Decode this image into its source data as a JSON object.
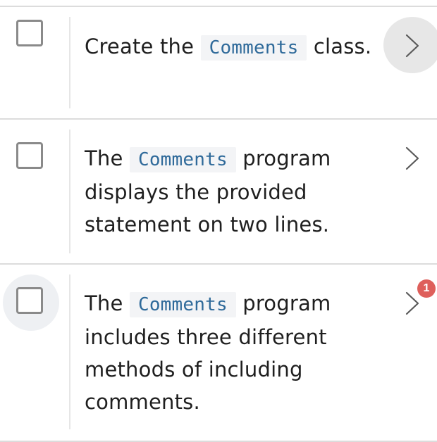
{
  "tasks": [
    {
      "before": "Create the ",
      "code": "Comments",
      "after": " class.",
      "checked": false
    },
    {
      "before": "The ",
      "code": "Comments",
      "after": " program displays the provided statement on two lines.",
      "checked": false
    },
    {
      "before": "The ",
      "code": "Comments",
      "after": " program includes three different methods of including comments.",
      "checked": false,
      "badge": "1"
    }
  ],
  "icons": {
    "checkbox": "checkbox-icon",
    "chevron": "chevron-right-icon"
  },
  "colors": {
    "code_text": "#2f6a9a",
    "code_bg": "#f3f4f6",
    "badge": "#de5f5b",
    "checkbox_border": "#8a8a8a",
    "divider": "#dcdcdc"
  }
}
